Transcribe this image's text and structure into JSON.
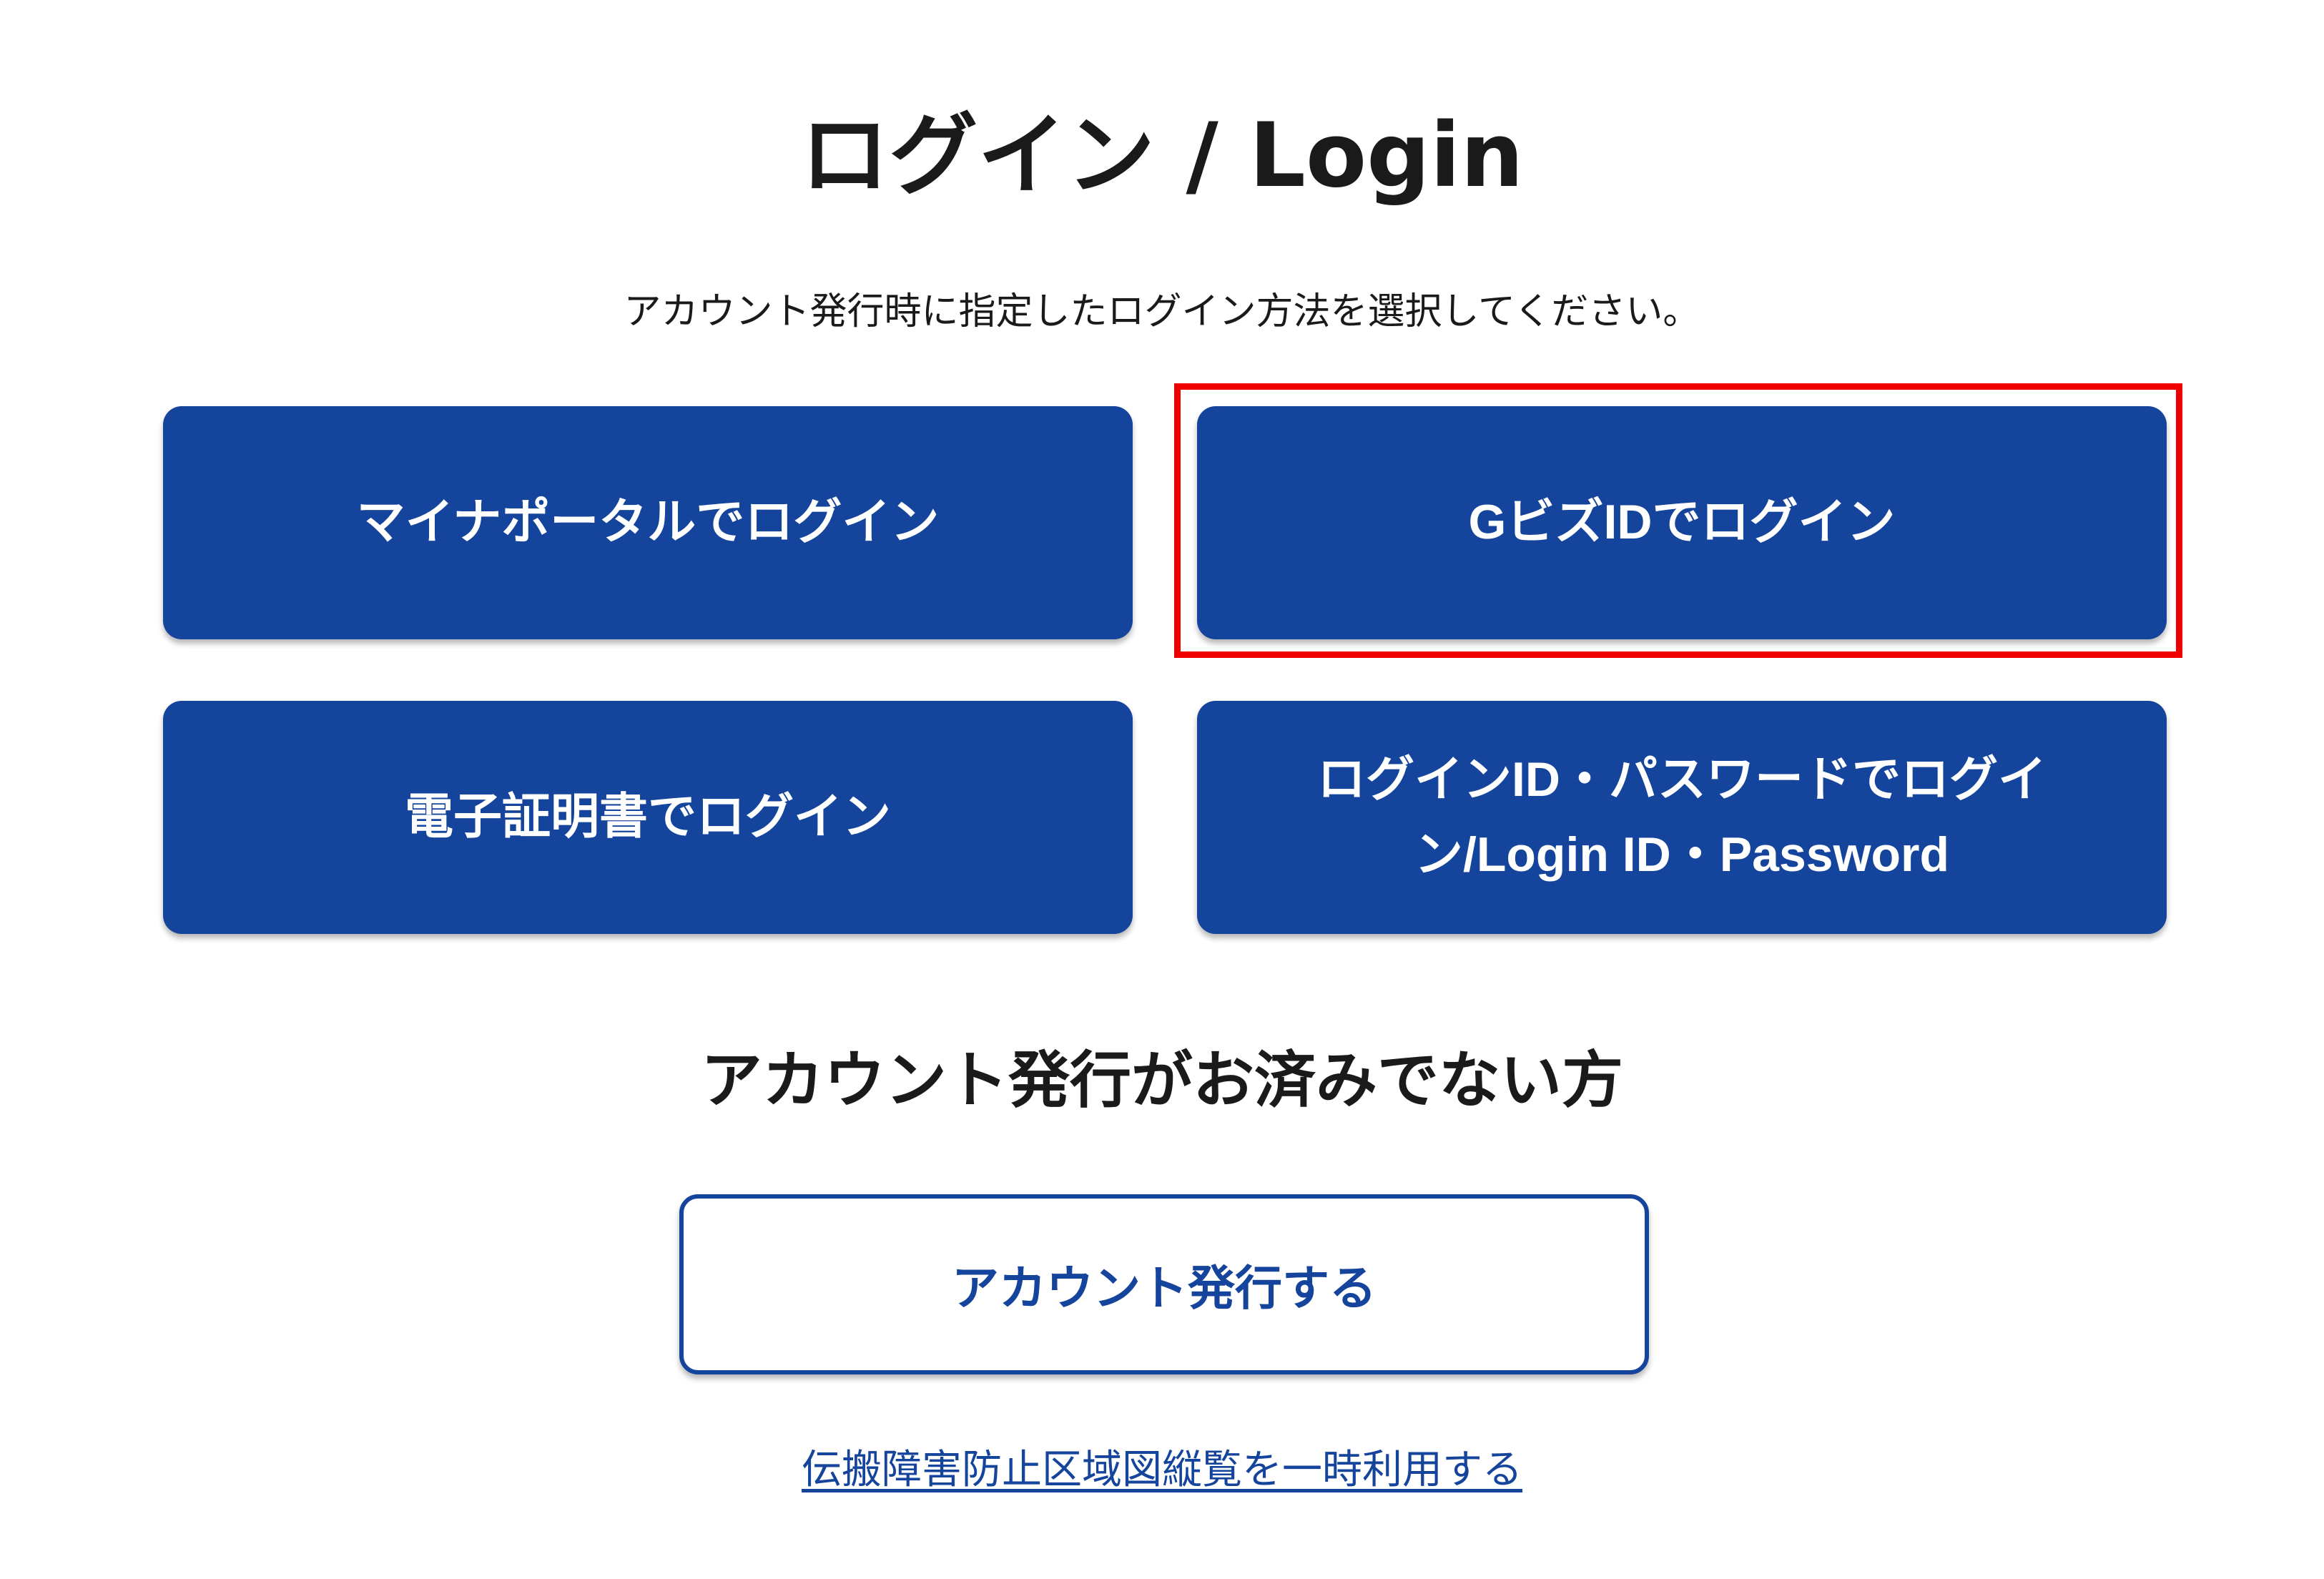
{
  "header": {
    "title": "ログイン / Login",
    "subtitle": "アカウント発行時に指定したログイン方法を選択してください。"
  },
  "login_options": {
    "myna_portal": "マイナポータルでログイン",
    "gbiz_id": "GビズIDでログイン",
    "digital_certificate": "電子証明書でログイン",
    "id_password": "ログインID・パスワードでログイン/Login ID・Password"
  },
  "register": {
    "heading": "アカウント発行がお済みでない方",
    "button": "アカウント発行する"
  },
  "footer": {
    "temporary_use_link": "伝搬障害防止区域図縦覧を一時利用する"
  },
  "colors": {
    "primary": "#14449b",
    "highlight": "#ee0000"
  }
}
